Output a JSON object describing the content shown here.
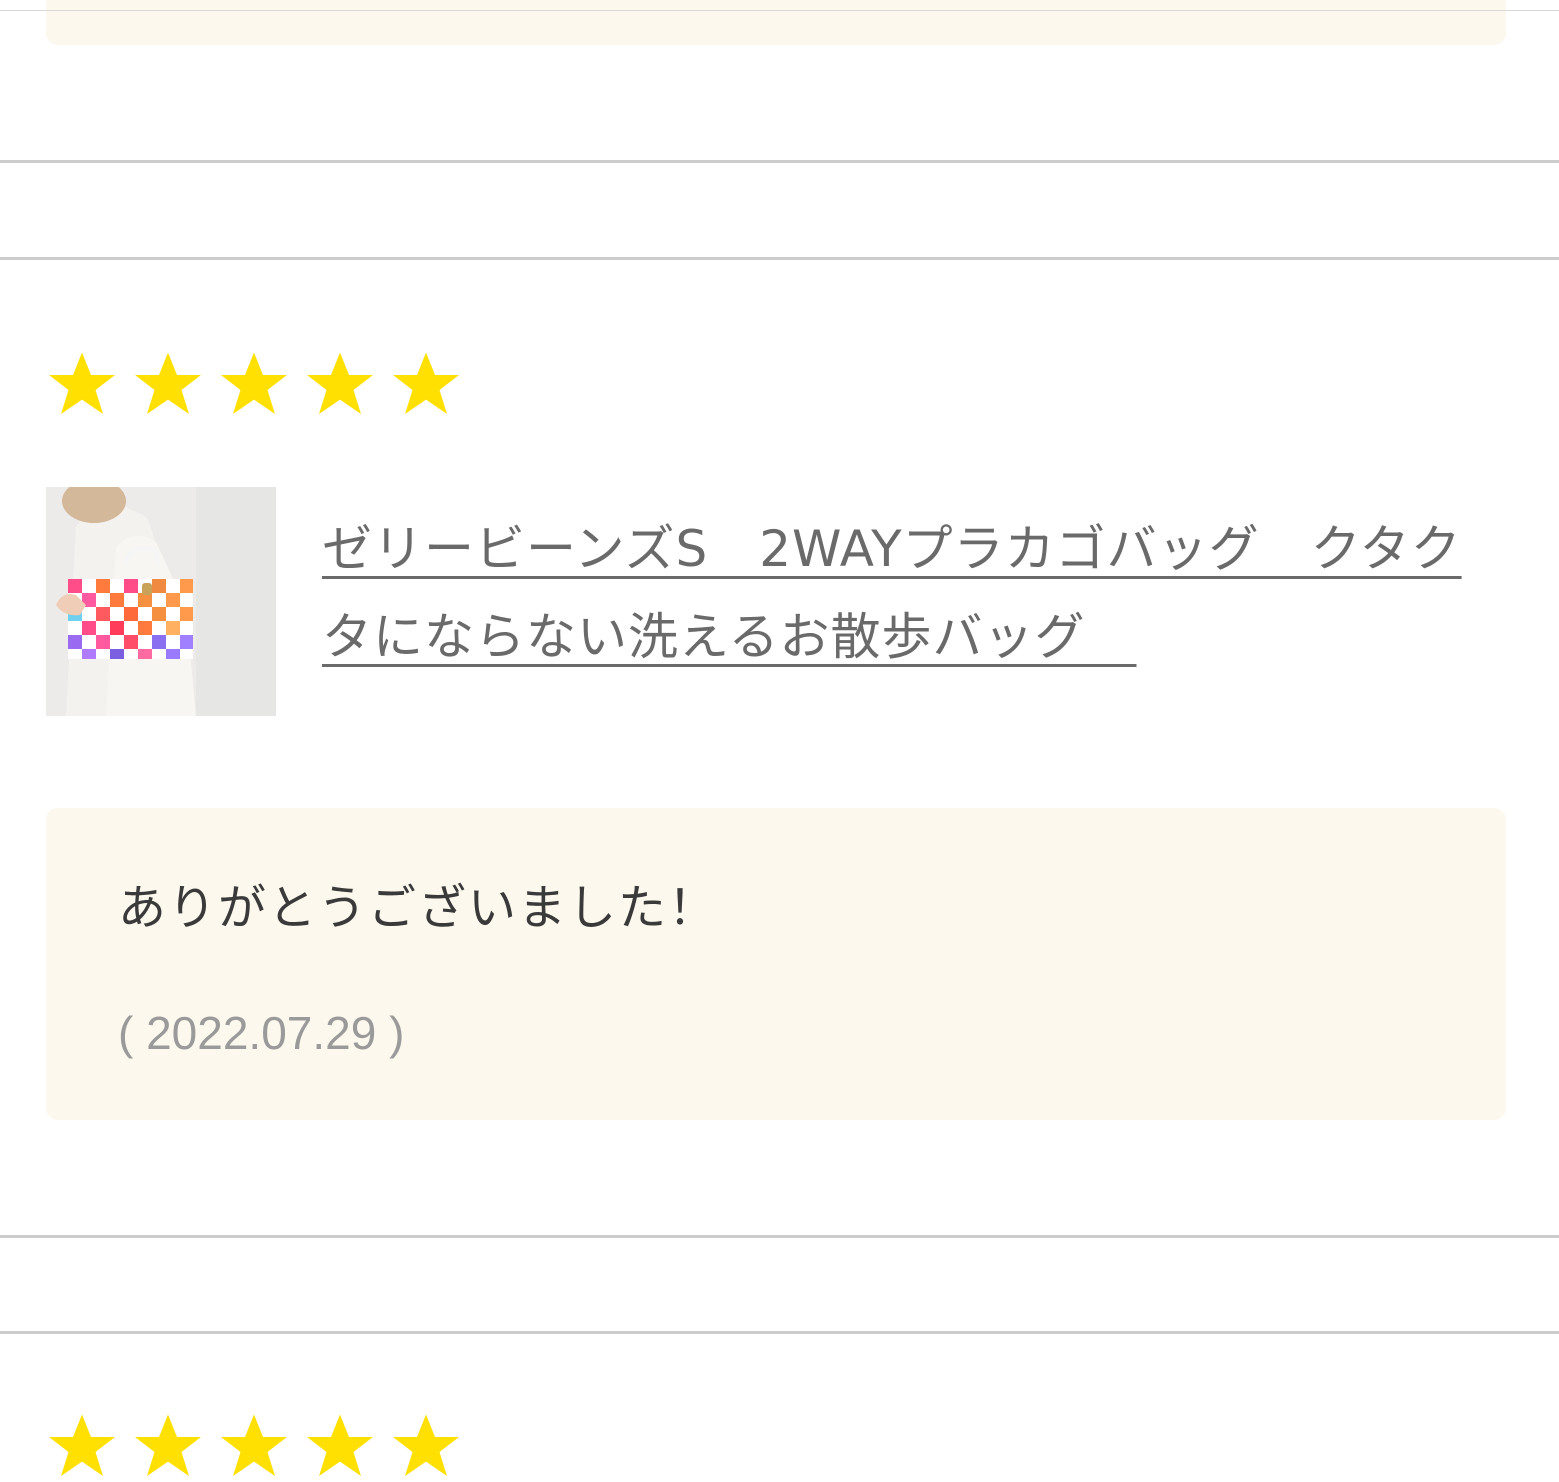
{
  "colors": {
    "star": "#FFE000",
    "comment_bg": "#FCF8EE",
    "divider": "#CCCCCC",
    "link": "#6A6A6A",
    "date": "#9A9A9A"
  },
  "review": {
    "rating": 5,
    "rating_max": 5,
    "product": {
      "title": "ゼリービーンズS　2WAYプラカゴバッグ　クタクタにならない洗えるお散歩バッグ　",
      "thumbnail": "product-thumbnail"
    },
    "comment": "ありがとうございました！",
    "date": "( 2022.07.29 )"
  },
  "next_review": {
    "rating": 5
  }
}
